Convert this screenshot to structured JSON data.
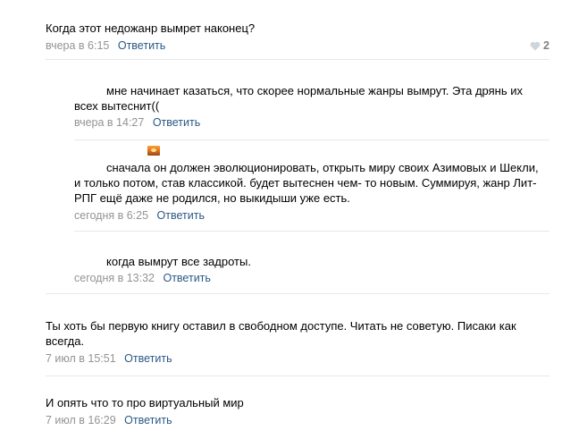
{
  "comments": [
    {
      "text": "Когда этот недожанр вымрет наконец?",
      "time": "вчера в 6:15",
      "reply": "Ответить",
      "likes": "2"
    },
    {
      "text": "мне начинает казаться, что скорее нормальные жанры вымрут. Эта дрянь их всех вытеснит((",
      "time": "вчера в 14:27",
      "reply": "Ответить"
    },
    {
      "text": "сначала он должен эволюционировать, открыть миру своих Азимовых и Шекли, и только потом, став классикой. будет вытеснен чем- то новым. Суммируя, жанр Лит-РПГ ещё даже не родился, но выкидыши уже есть.",
      "time": "сегодня в 6:25",
      "reply": "Ответить",
      "emoji_icon": "sunset-emoji-icon"
    },
    {
      "text": "когда вымрут все задроты.",
      "time": "сегодня в 13:32",
      "reply": "Ответить"
    },
    {
      "text": "Ты хоть бы первую книгу оставил в свободном доступе. Читать не советую. Писаки как всегда.",
      "time": "7 июл в 15:51",
      "reply": "Ответить"
    },
    {
      "text": "И опять что то про виртуальный мир",
      "time": "7 июл в 16:29",
      "reply": "Ответить"
    }
  ],
  "colors": {
    "link": "#2a5885",
    "meta": "#939393",
    "divider": "#e7e8ec"
  }
}
